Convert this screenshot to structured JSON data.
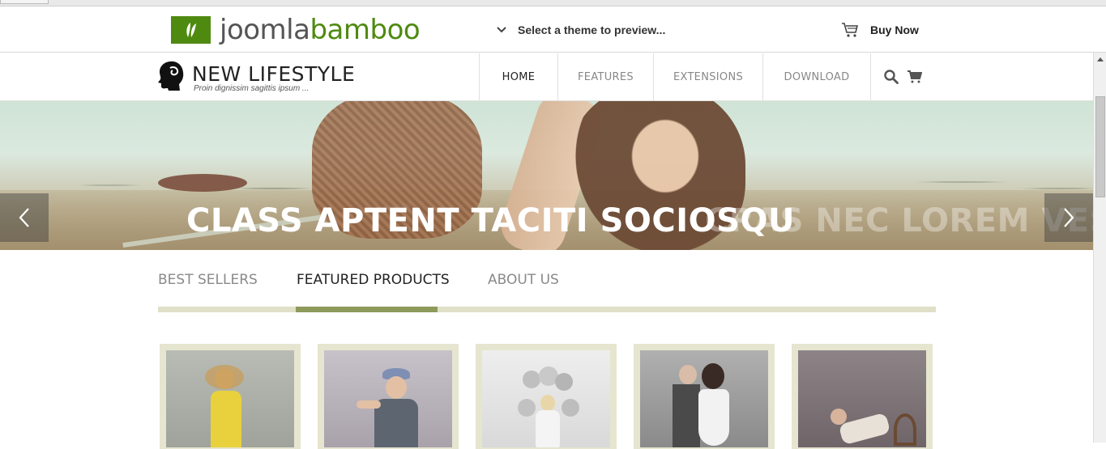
{
  "preview_bar": {
    "logo_text_part1": "joomla",
    "logo_text_part2": "bamboo",
    "theme_select_label": "Select a theme to preview...",
    "buy_now_label": "Buy Now",
    "brand_color": "#4f8a10"
  },
  "site": {
    "name": "NEW LIFESTYLE",
    "tagline": "Proin dignissim sagittis ipsum ...",
    "nav": [
      {
        "label": "HOME",
        "active": true
      },
      {
        "label": "FEATURES",
        "active": false
      },
      {
        "label": "EXTENSIONS",
        "active": false
      },
      {
        "label": "DOWNLOAD",
        "active": false
      }
    ],
    "icons": [
      "search-icon",
      "cart-icon"
    ]
  },
  "hero": {
    "title": "CLASS APTENT TACITI SOCIOSQU",
    "next_title_ghost": "CRAS NEC LOREM VEST"
  },
  "tabs": {
    "items": [
      {
        "label": "BEST SELLERS",
        "active": false
      },
      {
        "label": "FEATURED PRODUCTS",
        "active": true
      },
      {
        "label": "ABOUT US",
        "active": false
      }
    ],
    "accent_color": "#8e9a5a"
  },
  "products": {
    "count_visible": 5
  }
}
